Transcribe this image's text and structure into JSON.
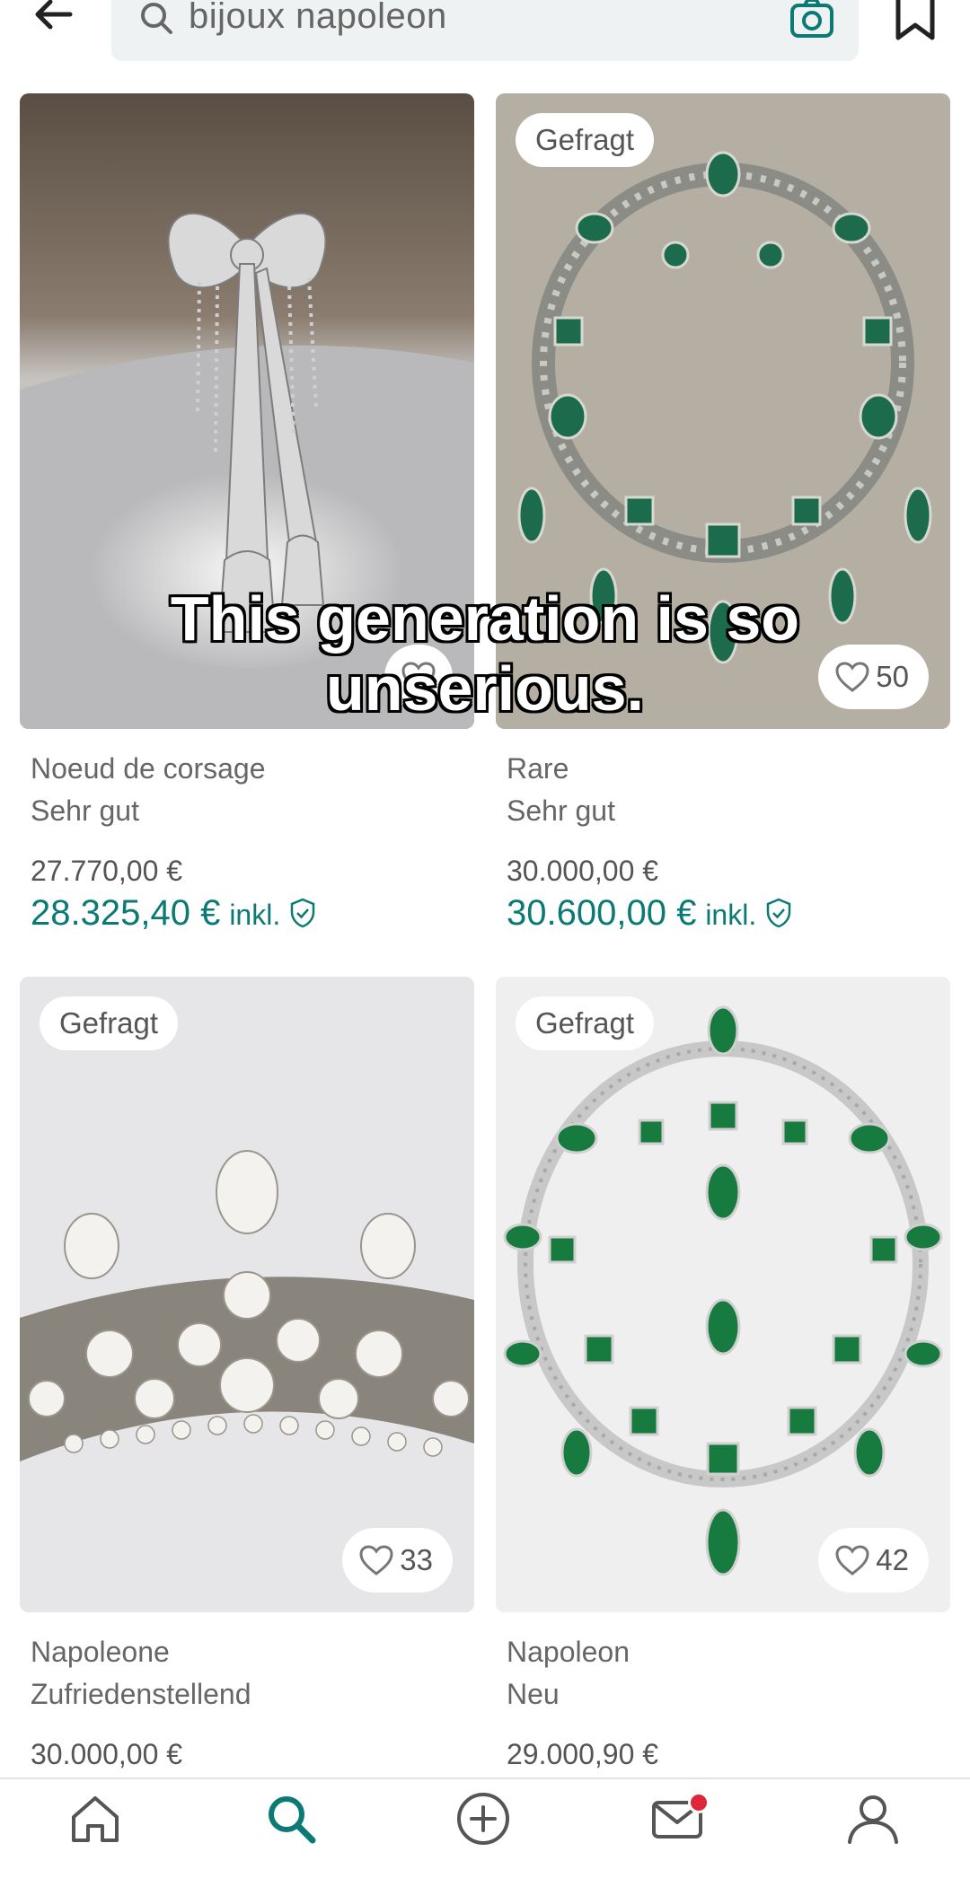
{
  "search": {
    "query": "bijoux napoleon"
  },
  "caption": {
    "line1": "This generation is so",
    "line2": "unserious."
  },
  "items": [
    {
      "title": "Noeud de corsage",
      "condition": "Sehr gut",
      "price": "27.770,00 €",
      "total": "28.325,40 €",
      "incl": "inkl.",
      "badge": "",
      "favorites": ""
    },
    {
      "title": "Rare",
      "condition": "Sehr gut",
      "price": "30.000,00 €",
      "total": "30.600,00 €",
      "incl": "inkl.",
      "badge": "Gefragt",
      "favorites": "50"
    },
    {
      "title": "Napoleone",
      "condition": "Zufriedenstellend",
      "price": "30.000,00 €",
      "total": "",
      "incl": "",
      "badge": "Gefragt",
      "favorites": "33"
    },
    {
      "title": "Napoleon",
      "condition": "Neu",
      "price": "29.000,90 €",
      "total": "",
      "incl": "",
      "badge": "Gefragt",
      "favorites": "42"
    }
  ],
  "nav": {
    "active": "search"
  },
  "colors": {
    "accent": "#0b7a75",
    "notification": "#e0263b"
  },
  "icons": [
    "back-arrow-icon",
    "search-icon",
    "camera-icon",
    "bookmark-icon",
    "heart-icon",
    "shield-check-icon",
    "home-icon",
    "plus-circle-icon",
    "mail-icon",
    "profile-icon"
  ]
}
